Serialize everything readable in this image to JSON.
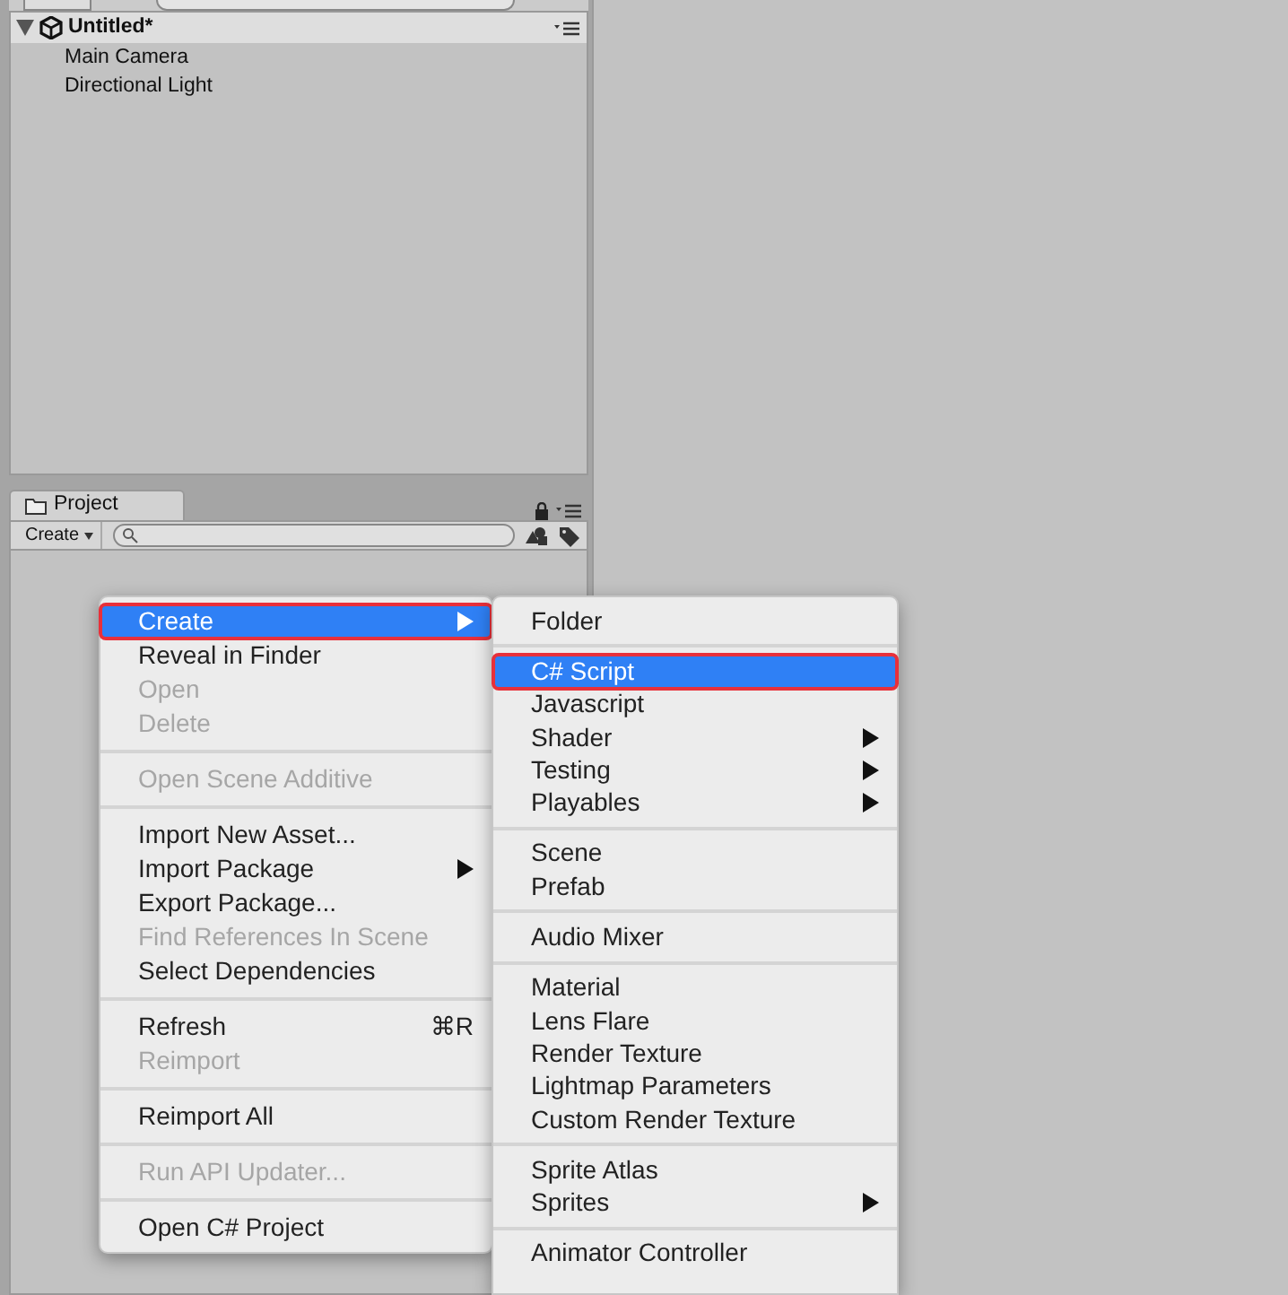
{
  "hierarchy": {
    "scene": {
      "title": "Untitled*",
      "expanded": true
    },
    "items": [
      "Main Camera",
      "Directional Light"
    ]
  },
  "project": {
    "tab": "Project",
    "create_button": "Create"
  },
  "context_menu": {
    "items": [
      {
        "kind": "item",
        "label": "Create",
        "selected": true,
        "disabled": false,
        "submenu": true,
        "annotated": true
      },
      {
        "kind": "item",
        "label": "Reveal in Finder",
        "selected": false,
        "disabled": false
      },
      {
        "kind": "item",
        "label": "Open",
        "selected": false,
        "disabled": true
      },
      {
        "kind": "item",
        "label": "Delete",
        "selected": false,
        "disabled": true
      },
      {
        "kind": "separator"
      },
      {
        "kind": "item",
        "label": "Open Scene Additive",
        "selected": false,
        "disabled": true
      },
      {
        "kind": "separator"
      },
      {
        "kind": "item",
        "label": "Import New Asset...",
        "selected": false,
        "disabled": false
      },
      {
        "kind": "item",
        "label": "Import Package",
        "selected": false,
        "disabled": false,
        "submenu": true
      },
      {
        "kind": "item",
        "label": "Export Package...",
        "selected": false,
        "disabled": false
      },
      {
        "kind": "item",
        "label": "Find References In Scene",
        "selected": false,
        "disabled": true
      },
      {
        "kind": "item",
        "label": "Select Dependencies",
        "selected": false,
        "disabled": false
      },
      {
        "kind": "separator"
      },
      {
        "kind": "item",
        "label": "Refresh",
        "selected": false,
        "disabled": false,
        "shortcut": "⌘R"
      },
      {
        "kind": "item",
        "label": "Reimport",
        "selected": false,
        "disabled": true
      },
      {
        "kind": "separator"
      },
      {
        "kind": "item",
        "label": "Reimport All",
        "selected": false,
        "disabled": false
      },
      {
        "kind": "separator"
      },
      {
        "kind": "item",
        "label": "Run API Updater...",
        "selected": false,
        "disabled": true
      },
      {
        "kind": "separator"
      },
      {
        "kind": "item",
        "label": "Open C# Project",
        "selected": false,
        "disabled": false
      }
    ]
  },
  "create_submenu": {
    "items": [
      {
        "kind": "item",
        "label": "Folder",
        "selected": false
      },
      {
        "kind": "separator"
      },
      {
        "kind": "item",
        "label": "C# Script",
        "selected": true,
        "annotated": true
      },
      {
        "kind": "item",
        "label": "Javascript",
        "selected": false
      },
      {
        "kind": "item",
        "label": "Shader",
        "selected": false,
        "submenu": true
      },
      {
        "kind": "item",
        "label": "Testing",
        "selected": false,
        "submenu": true
      },
      {
        "kind": "item",
        "label": "Playables",
        "selected": false,
        "submenu": true
      },
      {
        "kind": "separator"
      },
      {
        "kind": "item",
        "label": "Scene",
        "selected": false
      },
      {
        "kind": "item",
        "label": "Prefab",
        "selected": false
      },
      {
        "kind": "separator"
      },
      {
        "kind": "item",
        "label": "Audio Mixer",
        "selected": false
      },
      {
        "kind": "separator"
      },
      {
        "kind": "item",
        "label": "Material",
        "selected": false
      },
      {
        "kind": "item",
        "label": "Lens Flare",
        "selected": false
      },
      {
        "kind": "item",
        "label": "Render Texture",
        "selected": false
      },
      {
        "kind": "item",
        "label": "Lightmap Parameters",
        "selected": false
      },
      {
        "kind": "item",
        "label": "Custom Render Texture",
        "selected": false
      },
      {
        "kind": "separator"
      },
      {
        "kind": "item",
        "label": "Sprite Atlas",
        "selected": false
      },
      {
        "kind": "item",
        "label": "Sprites",
        "selected": false,
        "submenu": true
      },
      {
        "kind": "separator"
      },
      {
        "kind": "item",
        "label": "Animator Controller",
        "selected": false
      }
    ]
  }
}
